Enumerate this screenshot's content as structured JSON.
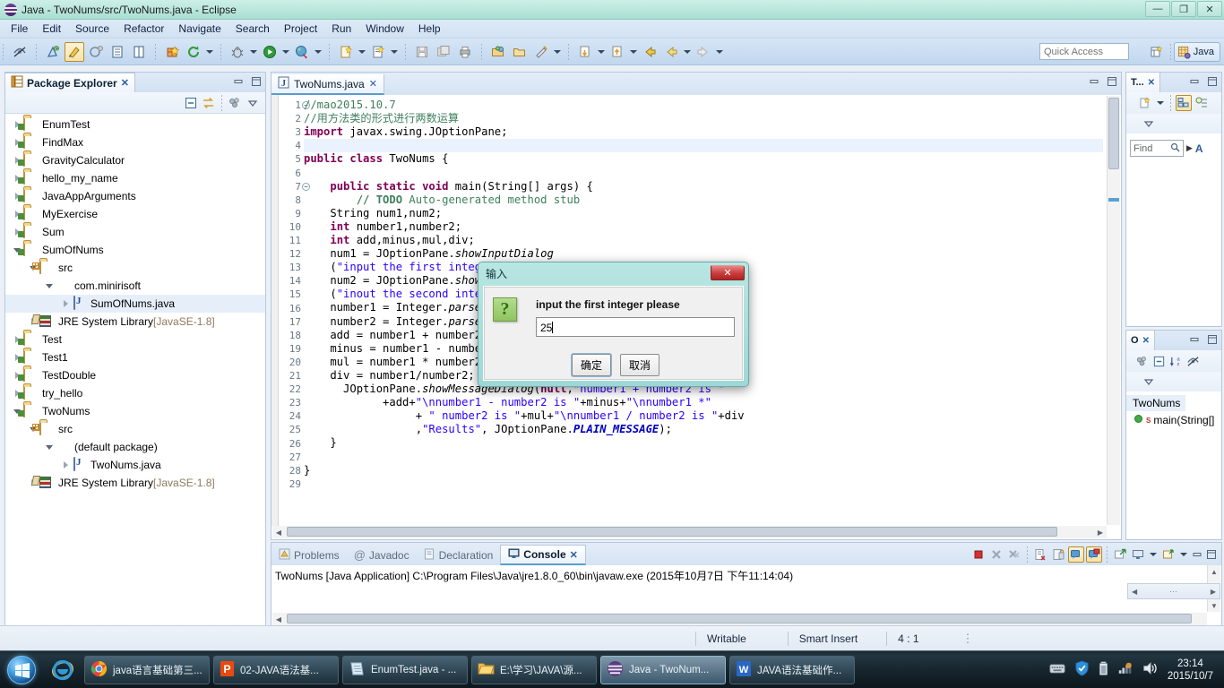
{
  "window": {
    "title": "Java - TwoNums/src/TwoNums.java - Eclipse",
    "app_icon": "eclipse-icon",
    "minimize": "—",
    "restore": "❐",
    "close": "✕"
  },
  "menubar": {
    "items": [
      "File",
      "Edit",
      "Source",
      "Refactor",
      "Navigate",
      "Search",
      "Project",
      "Run",
      "Window",
      "Help"
    ]
  },
  "toolbar": {
    "quick_access_placeholder": "Quick Access",
    "quick_access_value": "",
    "perspective_label": "Java",
    "open_perspective_tooltip": "Open Perspective"
  },
  "package_explorer": {
    "tab_label": "Package Explorer",
    "close_glyph": "✕",
    "minimize_glyph": "—",
    "maximize_glyph": "❐",
    "toolbar_icons": [
      "collapse-all-icon",
      "link-with-editor-icon",
      "view-menu-filter-icon",
      "view-menu-icon"
    ],
    "tree": [
      {
        "label": "EnumTest",
        "icon": "java-project-icon",
        "indent": 0,
        "state": "collapsed"
      },
      {
        "label": "FindMax",
        "icon": "java-project-icon",
        "indent": 0,
        "state": "collapsed"
      },
      {
        "label": "GravityCalculator",
        "icon": "java-project-icon",
        "indent": 0,
        "state": "collapsed"
      },
      {
        "label": "hello_my_name",
        "icon": "java-project-icon",
        "indent": 0,
        "state": "collapsed"
      },
      {
        "label": "JavaAppArguments",
        "icon": "java-project-icon",
        "indent": 0,
        "state": "collapsed"
      },
      {
        "label": "MyExercise",
        "icon": "java-project-icon",
        "indent": 0,
        "state": "collapsed"
      },
      {
        "label": "Sum",
        "icon": "java-project-icon",
        "indent": 0,
        "state": "collapsed"
      },
      {
        "label": "SumOfNums",
        "icon": "java-project-icon",
        "indent": 0,
        "state": "expanded"
      },
      {
        "label": "src",
        "icon": "source-folder-icon",
        "indent": 1,
        "state": "expanded"
      },
      {
        "label": "com.minirisoft",
        "icon": "package-icon",
        "indent": 2,
        "state": "expanded"
      },
      {
        "label": "SumOfNums.java",
        "icon": "java-file-icon",
        "indent": 3,
        "state": "collapsed",
        "selected": true
      },
      {
        "label": "JRE System Library",
        "suffix": "[JavaSE-1.8]",
        "icon": "jre-library-icon",
        "indent": 1,
        "state": "collapsed"
      },
      {
        "label": "Test",
        "icon": "java-project-icon",
        "indent": 0,
        "state": "collapsed"
      },
      {
        "label": "Test1",
        "icon": "java-project-icon",
        "indent": 0,
        "state": "collapsed"
      },
      {
        "label": "TestDouble",
        "icon": "java-project-icon",
        "indent": 0,
        "state": "collapsed"
      },
      {
        "label": "try_hello",
        "icon": "java-project-icon",
        "indent": 0,
        "state": "collapsed"
      },
      {
        "label": "TwoNums",
        "icon": "java-project-icon",
        "indent": 0,
        "state": "expanded"
      },
      {
        "label": "src",
        "icon": "source-folder-icon",
        "indent": 1,
        "state": "expanded"
      },
      {
        "label": "(default package)",
        "icon": "package-icon",
        "indent": 2,
        "state": "expanded"
      },
      {
        "label": "TwoNums.java",
        "icon": "java-file-icon",
        "indent": 3,
        "state": "collapsed"
      },
      {
        "label": "JRE System Library",
        "suffix": "[JavaSE-1.8]",
        "icon": "jre-library-icon",
        "indent": 1,
        "state": "collapsed"
      }
    ]
  },
  "editor": {
    "tab_label": "TwoNums.java",
    "tab_icon": "java-file-icon",
    "tab_close": "✕",
    "minimize_glyph": "—",
    "maximize_glyph": "❐",
    "highlight_line": 4,
    "lines": [
      {
        "n": 1,
        "folding": true,
        "html": "<span class=\"c\">//mao2015.10.7</span>"
      },
      {
        "n": 2,
        "html": "<span class=\"c\">//用方法类的形式进行两数运算</span>"
      },
      {
        "n": 3,
        "html": "<span class=\"k\">import</span> javax.swing.JOptionPane;"
      },
      {
        "n": 4,
        "html": ""
      },
      {
        "n": 5,
        "html": "<span class=\"k\">public class</span> TwoNums {"
      },
      {
        "n": 6,
        "html": ""
      },
      {
        "n": 7,
        "folding": true,
        "html": "    <span class=\"k\">public static void</span> main(String[] args) {"
      },
      {
        "n": 8,
        "html": "        <span class=\"tdo\">// TODO</span><span class=\"c\"> Auto-generated method stub</span>"
      },
      {
        "n": 9,
        "html": "    String num1,num2;"
      },
      {
        "n": 10,
        "html": "    <span class=\"k\">int</span> number1,number2;"
      },
      {
        "n": 11,
        "html": "    <span class=\"k\">int</span> add,minus,mul,div;"
      },
      {
        "n": 12,
        "html": "    num1 = JOptionPane.<span class=\"f\">showInputDialog</span>"
      },
      {
        "n": 13,
        "html": "    (<span class=\"s\">\"input the first integer please\"</span>);"
      },
      {
        "n": 14,
        "html": "    num2 = JOptionPane.<span class=\"f\">showInputDialog</span>"
      },
      {
        "n": 15,
        "html": "    (<span class=\"s\">\"inout the second integer please\"</span>);"
      },
      {
        "n": 16,
        "html": "    number1 = Integer.<span class=\"f\">parseInt</span>(num1);"
      },
      {
        "n": 17,
        "html": "    number2 = Integer.<span class=\"f\">parseInt</span>(num2);"
      },
      {
        "n": 18,
        "html": "    add = number1 + number2;"
      },
      {
        "n": 19,
        "html": "    minus = number1 - number2;"
      },
      {
        "n": 20,
        "html": "    mul = number1 * number2;"
      },
      {
        "n": 21,
        "html": "    div = number1/number2;"
      },
      {
        "n": 22,
        "html": "      JOptionPane.<span class=\"f\">showMessageDialog</span>(<span class=\"k\">null</span>,<span class=\"s\">\"number1 + number2 is \"</span>"
      },
      {
        "n": 23,
        "html": "            +add+<span class=\"s\">\"\\nnumber1 - number2 is \"</span>+minus+<span class=\"s\">\"\\nnumber1 *\"</span>"
      },
      {
        "n": 24,
        "html": "                 + <span class=\"s\">\" number2 is \"</span>+mul+<span class=\"s\">\"\\nnumber1 / number2 is \"</span>+div"
      },
      {
        "n": 25,
        "html": "                 ,<span class=\"s\">\"Results\"</span>, JOptionPane.<span class=\"st\">PLAIN_MESSAGE</span>);"
      },
      {
        "n": 26,
        "html": "    }"
      },
      {
        "n": 27,
        "html": ""
      },
      {
        "n": 28,
        "html": "}"
      },
      {
        "n": 29,
        "html": ""
      }
    ]
  },
  "bottom_panel": {
    "tabs": [
      {
        "label": "Problems",
        "icon": "problems-icon",
        "active": false
      },
      {
        "label": "Javadoc",
        "icon": "javadoc-icon",
        "active": false
      },
      {
        "label": "Declaration",
        "icon": "declaration-icon",
        "active": false
      },
      {
        "label": "Console",
        "icon": "console-icon",
        "active": true,
        "close": "✕"
      }
    ],
    "console_line": "TwoNums [Java Application] C:\\Program Files\\Java\\jre1.8.0_60\\bin\\javaw.exe (2015年10月7日 下午11:14:04)",
    "tools": [
      "terminate-icon",
      "remove-launch-icon",
      "remove-all-launches-icon",
      "clear-console-icon",
      "scroll-lock-icon",
      "pin-console-icon",
      "display-selected-console-icon",
      "open-console-icon",
      "new-console-view-icon",
      "minimize-icon",
      "maximize-icon"
    ]
  },
  "right_views": {
    "top": {
      "tab_label": "T...",
      "close_glyph": "✕",
      "minimize_glyph": "—",
      "maximize_glyph": "❐",
      "find_placeholder": "Find",
      "find_value": "",
      "next_label": "A"
    },
    "bottom": {
      "tab_label": "O",
      "close_glyph": "✕",
      "minimize_glyph": "—",
      "maximize_glyph": "❐",
      "items": [
        {
          "label": "TwoNums",
          "icon": "class-icon",
          "selected": true
        },
        {
          "label": "main(String[]",
          "icon": "public-static-method-icon",
          "modifier": "S"
        }
      ]
    }
  },
  "statusbar": {
    "writable": "Writable",
    "insert_mode": "Smart Insert",
    "cursor_position": "4 : 1"
  },
  "dialog": {
    "title": "输入",
    "close_glyph": "✕",
    "icon": "question-icon",
    "icon_glyph": "?",
    "message": "input the first integer please",
    "input_value": "25",
    "ok_label": "确定",
    "cancel_label": "取消"
  },
  "taskbar": {
    "start_tooltip": "Start",
    "pinned": [
      {
        "label": "",
        "icon": "internet-explorer-icon"
      }
    ],
    "items": [
      {
        "label": "java语言基础第三...",
        "icon": "chrome-icon",
        "active": false
      },
      {
        "label": "02-JAVA语法基...",
        "icon": "powerpoint-icon",
        "active": false
      },
      {
        "label": "EnumTest.java - ...",
        "icon": "notepad-icon",
        "active": false
      },
      {
        "label": "E:\\学习\\JAVA\\源...",
        "icon": "folder-icon",
        "active": false
      },
      {
        "label": "Java - TwoNum...",
        "icon": "eclipse-icon",
        "active": true
      },
      {
        "label": "JAVA语法基础作...",
        "icon": "wps-writer-icon",
        "active": false
      }
    ],
    "tray_icons": [
      "input-method-icon",
      "security-shield-icon",
      "battery-icon",
      "network-icon",
      "volume-icon"
    ],
    "clock_time": "23:14",
    "clock_date": "2015/10/7"
  }
}
